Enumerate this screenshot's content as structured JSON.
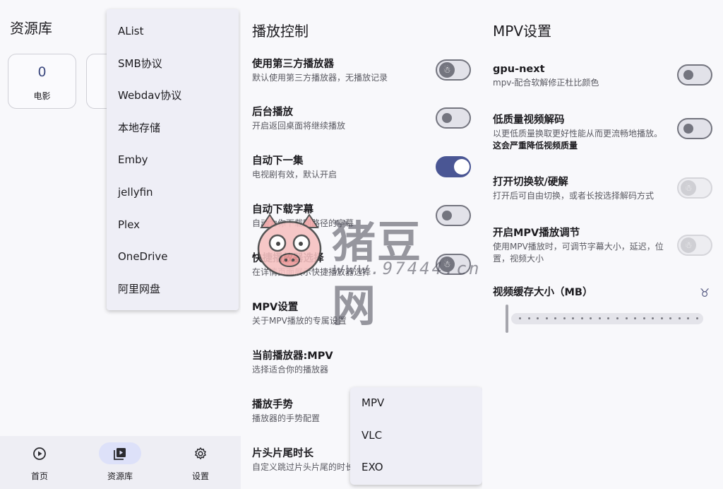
{
  "library": {
    "title": "资源库",
    "stats": [
      {
        "value": "0",
        "label": "电影"
      }
    ]
  },
  "source_menu": {
    "items": [
      "AList",
      "SMB协议",
      "Webdav协议",
      "本地存储",
      "Emby",
      "jellyfin",
      "Plex",
      "OneDrive",
      "阿里网盘"
    ]
  },
  "bottom_nav": {
    "items": [
      {
        "label": "首页",
        "icon": "play-circle-icon",
        "active": false
      },
      {
        "label": "资源库",
        "icon": "video-library-icon",
        "active": true
      },
      {
        "label": "设置",
        "icon": "gear-icon",
        "active": false
      }
    ]
  },
  "playback": {
    "title": "播放控制",
    "settings": [
      {
        "title": "使用第三方播放器",
        "subtitle": "默认使用第三方播放器，无播放记录",
        "toggle": "off"
      },
      {
        "title": "后台播放",
        "subtitle": "开启返回桌面将继续播放",
        "toggle": "off"
      },
      {
        "title": "自动下一集",
        "subtitle": "电视剧有效，默认开启",
        "toggle": "on"
      },
      {
        "title": "自动下载字幕",
        "subtitle": "自动为你下载同路径的字幕",
        "toggle": "off"
      },
      {
        "title": "快捷播放器选择",
        "subtitle": "在详情页面展示快捷播放器选择",
        "toggle": "off"
      },
      {
        "title": "MPV设置",
        "subtitle": "关于MPV播放的专属设置"
      },
      {
        "title": "当前播放器:MPV",
        "subtitle": "选择适合你的播放器"
      },
      {
        "title": "播放手势",
        "subtitle": "播放器的手势配置"
      },
      {
        "title": "片头片尾时长",
        "subtitle": "自定义跳过片头片尾的时长"
      }
    ]
  },
  "player_menu": {
    "items": [
      "MPV",
      "VLC",
      "EXO"
    ]
  },
  "mpv": {
    "title": "MPV设置",
    "settings": [
      {
        "title": "gpu-next",
        "subtitle": "mpv-配合软解修正杜比颜色",
        "toggle": "off"
      },
      {
        "title": "低质量视频解码",
        "subtitle": "以更低质量换取更好性能从而更流畅地播放。",
        "subtitle_bold": "这会严重降低视频质量",
        "toggle": "off"
      },
      {
        "title": "打开切换软/硬解",
        "subtitle": "打开后可自由切换，或者长按选择解码方式",
        "toggle": "disabled"
      },
      {
        "title": "开启MPV播放调节",
        "subtitle": "使用MPV播放时，可调节字幕大小，延迟，位置，视频大小",
        "toggle": "disabled"
      }
    ],
    "cache": {
      "label": "视频缓存大小（MB）",
      "value_fraction": 0.0
    }
  },
  "watermark": {
    "cn": "猪豆网",
    "url": "www.97444.cn"
  }
}
